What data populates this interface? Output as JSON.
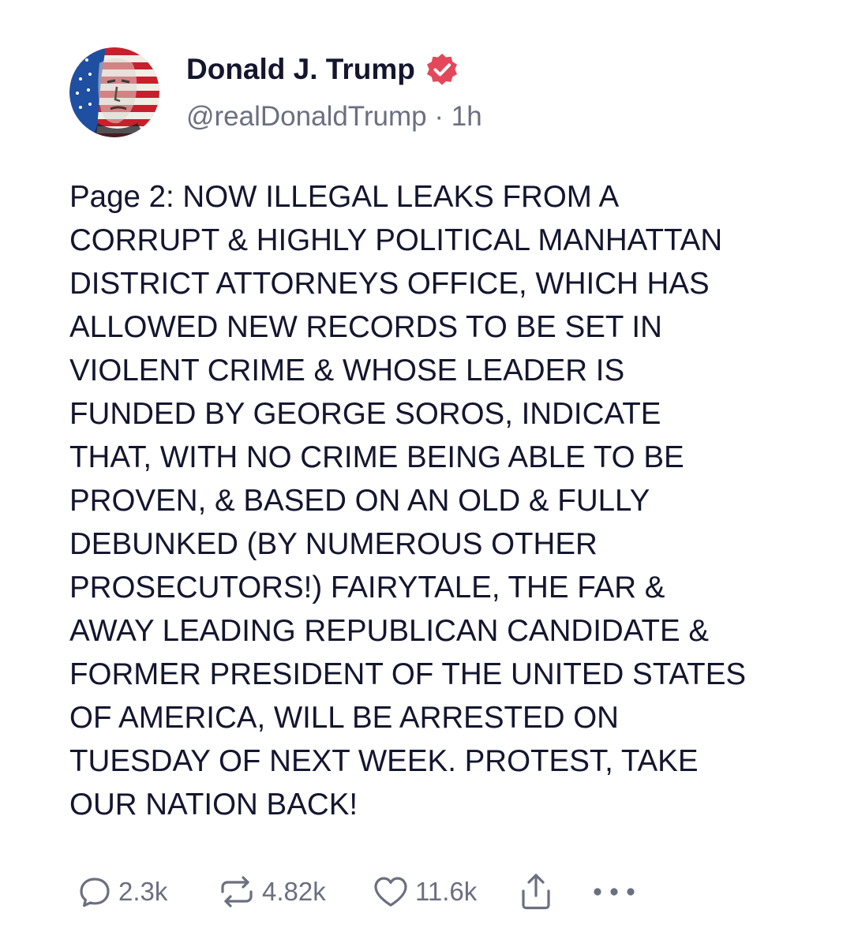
{
  "author": {
    "display_name": "Donald J. Trump",
    "handle": "@realDonaldTrump",
    "separator": "·",
    "time": "1h",
    "verified": true,
    "avatar_icon": "avatar-flag-portrait"
  },
  "post": {
    "lines": [
      "Page 2: NOW ILLEGAL LEAKS FROM A",
      "CORRUPT & HIGHLY POLITICAL MANHATTAN",
      "DISTRICT ATTORNEYS OFFICE, WHICH HAS",
      "ALLOWED NEW RECORDS TO BE SET IN",
      "VIOLENT CRIME & WHOSE LEADER IS",
      "FUNDED BY GEORGE SOROS, INDICATE",
      "THAT, WITH NO CRIME BEING ABLE TO BE",
      "PROVEN, & BASED ON AN OLD & FULLY",
      "DEBUNKED (BY NUMEROUS OTHER",
      "PROSECUTORS!) FAIRYTALE, THE FAR &",
      "AWAY LEADING REPUBLICAN CANDIDATE &",
      "FORMER PRESIDENT OF THE UNITED STATES",
      "OF AMERICA, WILL BE ARRESTED ON",
      "TUESDAY OF NEXT WEEK. PROTEST, TAKE",
      "OUR NATION BACK!"
    ]
  },
  "actions": {
    "replies": "2.3k",
    "reposts": "4.82k",
    "likes": "11.6k",
    "icons": [
      "reply-icon",
      "repost-icon",
      "like-icon",
      "share-icon",
      "more-icon"
    ]
  },
  "colors": {
    "text": "#14162f",
    "muted": "#6b6f80",
    "verified": "#e3485a",
    "background": "#ffffff"
  }
}
